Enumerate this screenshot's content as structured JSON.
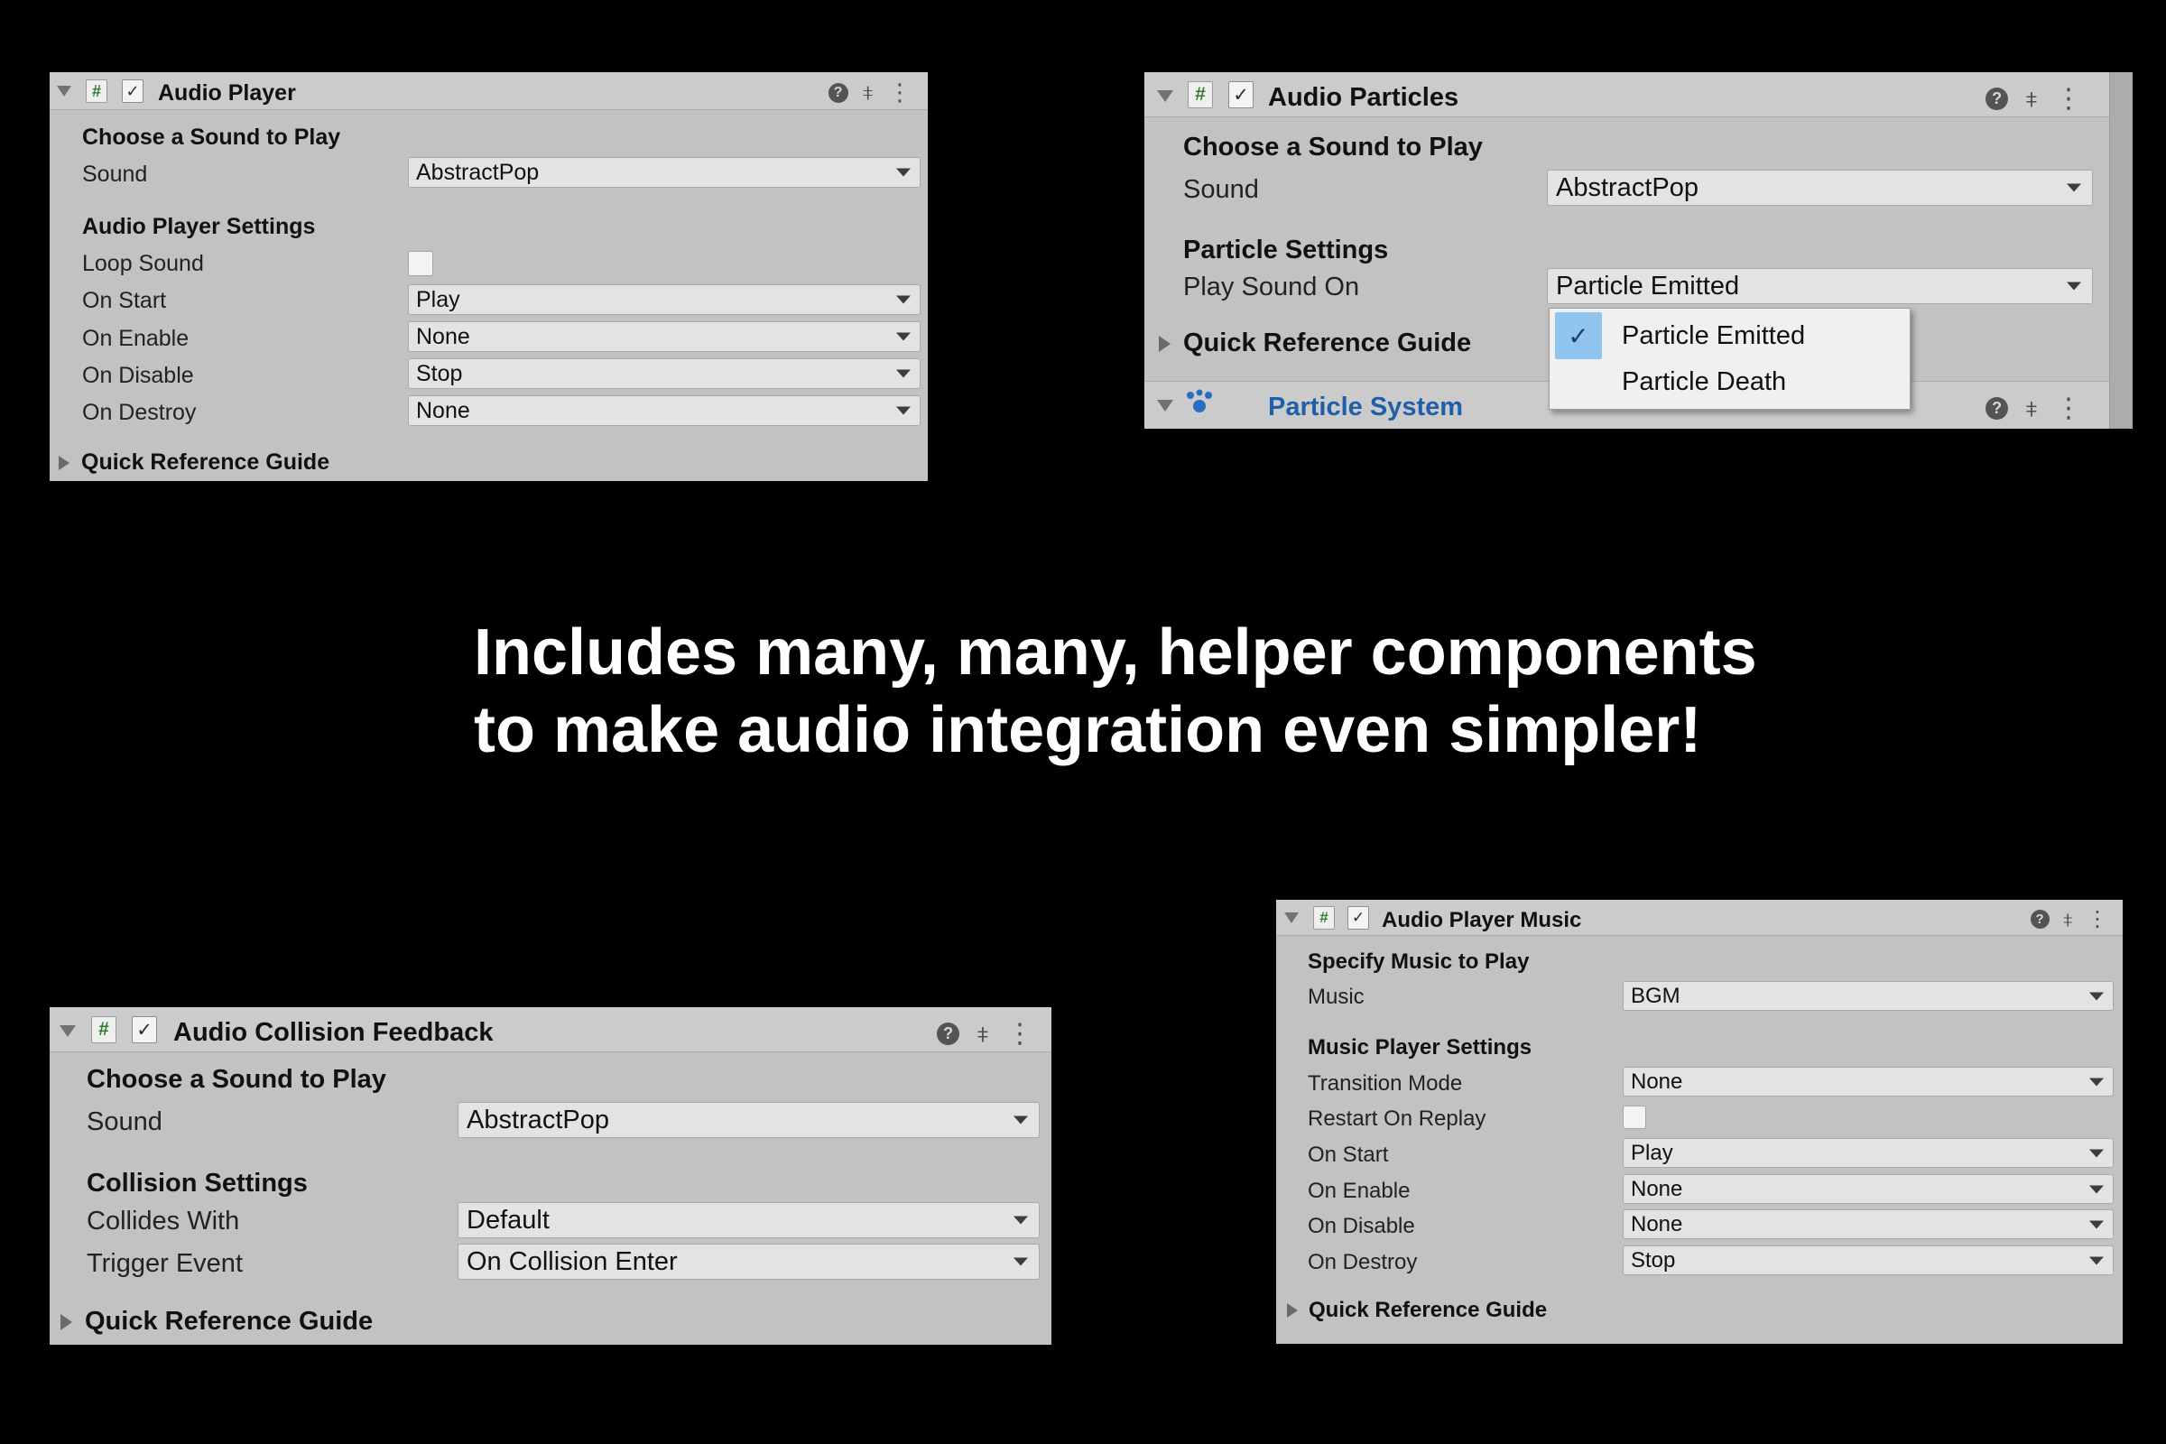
{
  "headline": {
    "line1": "Includes many, many, helper components",
    "line2": "to make audio integration even simpler!"
  },
  "icons": {
    "fold_expanded": "chevron-down-icon",
    "fold_collapsed": "chevron-right-icon",
    "script": "hash-icon",
    "enabled": "checkmark-icon",
    "help": "help-icon",
    "presets": "sliders-icon",
    "menu": "kebab-menu-icon",
    "particle_system": "particle-system-icon"
  },
  "colors": {
    "background": "#000000",
    "panel": "#c2c2c2",
    "header": "#cbcbcb",
    "field": "#e3e3e3",
    "link_title": "#1f5fa8",
    "menu_selected": "#8ec4ee"
  },
  "audio_player": {
    "title": "Audio Player",
    "section_sound": "Choose a Sound to Play",
    "sound_label": "Sound",
    "sound_value": "AbstractPop",
    "section_settings": "Audio Player Settings",
    "loop_label": "Loop Sound",
    "loop_checked": false,
    "on_start_label": "On Start",
    "on_start_value": "Play",
    "on_enable_label": "On Enable",
    "on_enable_value": "None",
    "on_disable_label": "On Disable",
    "on_disable_value": "Stop",
    "on_destroy_label": "On Destroy",
    "on_destroy_value": "None",
    "guide": "Quick Reference Guide"
  },
  "audio_particles": {
    "title": "Audio Particles",
    "section_sound": "Choose a Sound to Play",
    "sound_label": "Sound",
    "sound_value": "AbstractPop",
    "section_settings": "Particle Settings",
    "play_on_label": "Play Sound On",
    "play_on_value": "Particle Emitted",
    "guide": "Quick Reference Guide",
    "particle_system_title": "Particle System",
    "menu": [
      "Particle Emitted",
      "Particle Death"
    ],
    "menu_selected": "Particle Emitted"
  },
  "audio_collision": {
    "title": "Audio Collision Feedback",
    "section_sound": "Choose a Sound to Play",
    "sound_label": "Sound",
    "sound_value": "AbstractPop",
    "section_settings": "Collision Settings",
    "collides_label": "Collides With",
    "collides_value": "Default",
    "trigger_label": "Trigger Event",
    "trigger_value": "On Collision Enter",
    "guide": "Quick Reference Guide"
  },
  "audio_music": {
    "title": "Audio Player Music",
    "section_music": "Specify Music to Play",
    "music_label": "Music",
    "music_value": "BGM",
    "section_settings": "Music Player Settings",
    "transition_label": "Transition Mode",
    "transition_value": "None",
    "restart_label": "Restart On Replay",
    "restart_checked": false,
    "on_start_label": "On Start",
    "on_start_value": "Play",
    "on_enable_label": "On Enable",
    "on_enable_value": "None",
    "on_disable_label": "On Disable",
    "on_disable_value": "None",
    "on_destroy_label": "On Destroy",
    "on_destroy_value": "Stop",
    "guide": "Quick Reference Guide"
  }
}
